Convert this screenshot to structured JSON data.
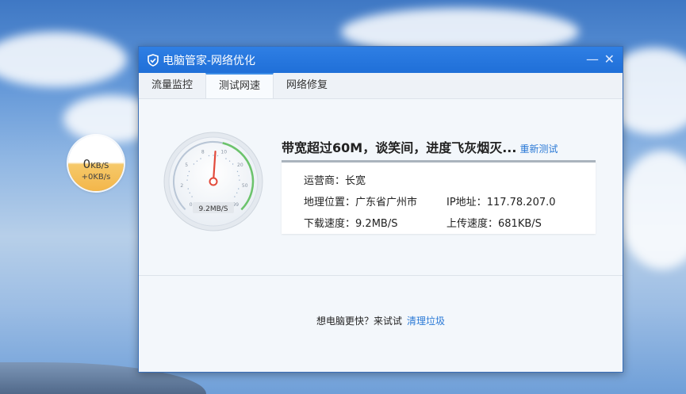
{
  "window": {
    "title": "电脑管家-网络优化"
  },
  "tabs": [
    {
      "label": "流量监控"
    },
    {
      "label": "测试网速",
      "active": true
    },
    {
      "label": "网络修复"
    }
  ],
  "gauge": {
    "ticks": [
      "0",
      "2",
      "5",
      "8",
      "10",
      "20",
      "50",
      "99"
    ],
    "readout": "9.2MB/S",
    "needle_value_mbps": 9.2
  },
  "result": {
    "headline": "带宽超过60M，谈笑间，进度飞灰烟灭...",
    "retest_label": "重新测试",
    "isp_label": "运营商：",
    "isp_value": "长宽",
    "location_label": "地理位置：",
    "location_value": "广东省广州市",
    "ip_label": "IP地址：",
    "ip_value": "117.78.207.0",
    "download_label": "下载速度：",
    "download_value": "9.2MB/S",
    "upload_label": "上传速度：",
    "upload_value": "681KB/S"
  },
  "promo": {
    "text": "想电脑更快？来试试",
    "link": "清理垃圾"
  },
  "speed_ball": {
    "down_value": "0",
    "down_unit": "KB/S",
    "up_text": "+0KB/s"
  },
  "colors": {
    "accent": "#2a79d6",
    "titlebar": "#1f6fd8",
    "gauge_green": "#6cc36c",
    "needle": "#e24a3b"
  },
  "icons": [
    "shield-icon",
    "minimize-icon",
    "close-icon"
  ]
}
